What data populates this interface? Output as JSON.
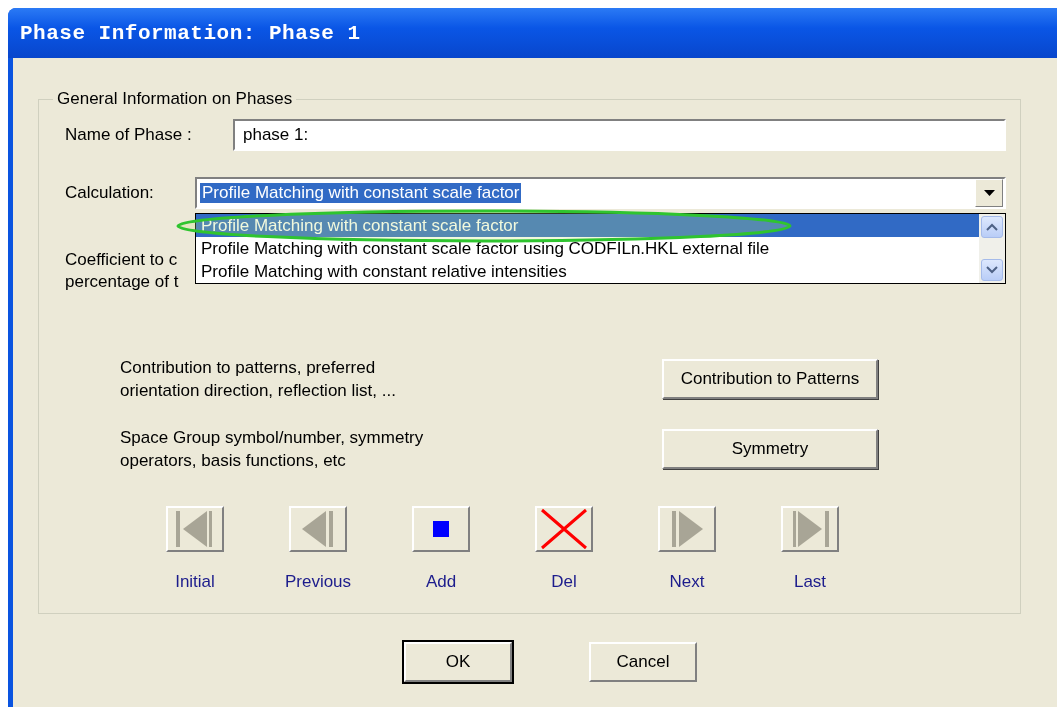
{
  "window": {
    "title": "Phase Information: Phase 1"
  },
  "group": {
    "title": "General Information on Phases"
  },
  "name_field": {
    "label": "Name of Phase :",
    "value": "phase 1:"
  },
  "calculation": {
    "label": "Calculation:",
    "value": "Profile Matching with constant scale factor",
    "expanded": true,
    "options": [
      {
        "label": "Profile Matching with constant scale factor",
        "selected": true
      },
      {
        "label": "Profile Matching with constant scale factor using CODFILn.HKL external file",
        "selected": false
      },
      {
        "label": "Profile Matching with constant relative intensities",
        "selected": false
      }
    ]
  },
  "coefficient": {
    "lines": [
      "Coefficient to c",
      "percentage of t"
    ]
  },
  "actions": [
    {
      "description": "Contribution to patterns, preferred orientation direction, reflection list, ...",
      "button": "Contribution to Patterns"
    },
    {
      "description": "Space Group symbol/number, symmetry operators, basis functions, etc",
      "button": "Symmetry"
    }
  ],
  "navigation": [
    {
      "kind": "first",
      "label": "Initial"
    },
    {
      "kind": "previous",
      "label": "Previous"
    },
    {
      "kind": "add",
      "label": "Add"
    },
    {
      "kind": "delete",
      "label": "Del"
    },
    {
      "kind": "next",
      "label": "Next"
    },
    {
      "kind": "last",
      "label": "Last"
    }
  ],
  "buttons": [
    {
      "label": "OK",
      "default": true
    },
    {
      "label": "Cancel",
      "default": false
    }
  ]
}
